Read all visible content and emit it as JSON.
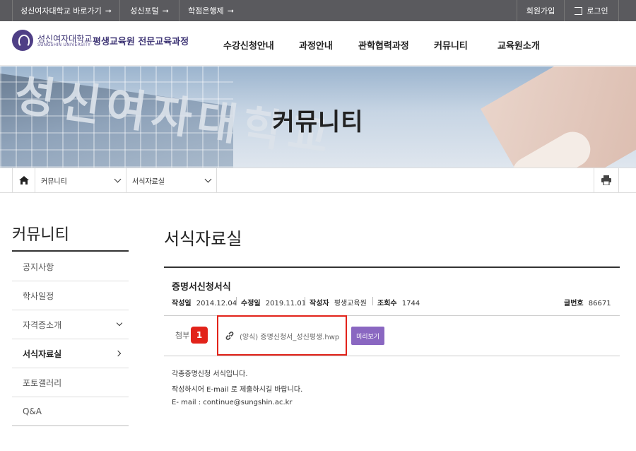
{
  "topbar": {
    "links": [
      {
        "label": "성신여자대학교 바로가기",
        "arrow": "➞"
      },
      {
        "label": "성신포털",
        "arrow": "➞"
      },
      {
        "label": "학점은행제",
        "arrow": "➞"
      }
    ],
    "join_label": "회원가입",
    "login_label": "로그인"
  },
  "header": {
    "univ_name": "성신여자대학교",
    "univ_sub": "SUNGSHIN UNIVERSITY",
    "program_name": "평생교육원 전문교육과정",
    "nav": [
      "수강신청안내",
      "과정안내",
      "관학협력과정",
      "커뮤니티",
      "교육원소개"
    ]
  },
  "banner": {
    "title": "커뮤니티",
    "building_letters": "성신여자대학교"
  },
  "location": {
    "level1": "커뮤니티",
    "level2": "서식자료실"
  },
  "sidebar": {
    "title": "커뮤니티",
    "items": [
      {
        "label": "공지사항"
      },
      {
        "label": "학사일정"
      },
      {
        "label": "자격증소개"
      },
      {
        "label": "서식자료실"
      },
      {
        "label": "포토갤러리"
      },
      {
        "label": "Q&A"
      }
    ]
  },
  "content": {
    "page_title": "서식자료실",
    "post": {
      "title": "증명서신청서식",
      "created_label": "작성일",
      "created": "2014.12.04",
      "modified_label": "수정일",
      "modified": "2019.11.01",
      "author_label": "작성자",
      "author": "평생교육원",
      "views_label": "조회수",
      "views": "1744",
      "post_no_label": "글번호",
      "post_no": "86671",
      "attach_label": "첨부",
      "attach_file": "(양식) 증명신청서_성신평생.hwp",
      "preview_label": "미리보기",
      "badge": "1",
      "body": [
        "각종증명신청 서식입니다.",
        "작성하시어 E-mail 로 제출하시길 바랍니다.",
        "E- mail : continue@sungshin.ac.kr"
      ]
    }
  },
  "colors": {
    "topbar": "#5a5a5e",
    "brand": "#3f3676",
    "accent_button": "#8a67c1",
    "highlight": "#e2231a"
  }
}
